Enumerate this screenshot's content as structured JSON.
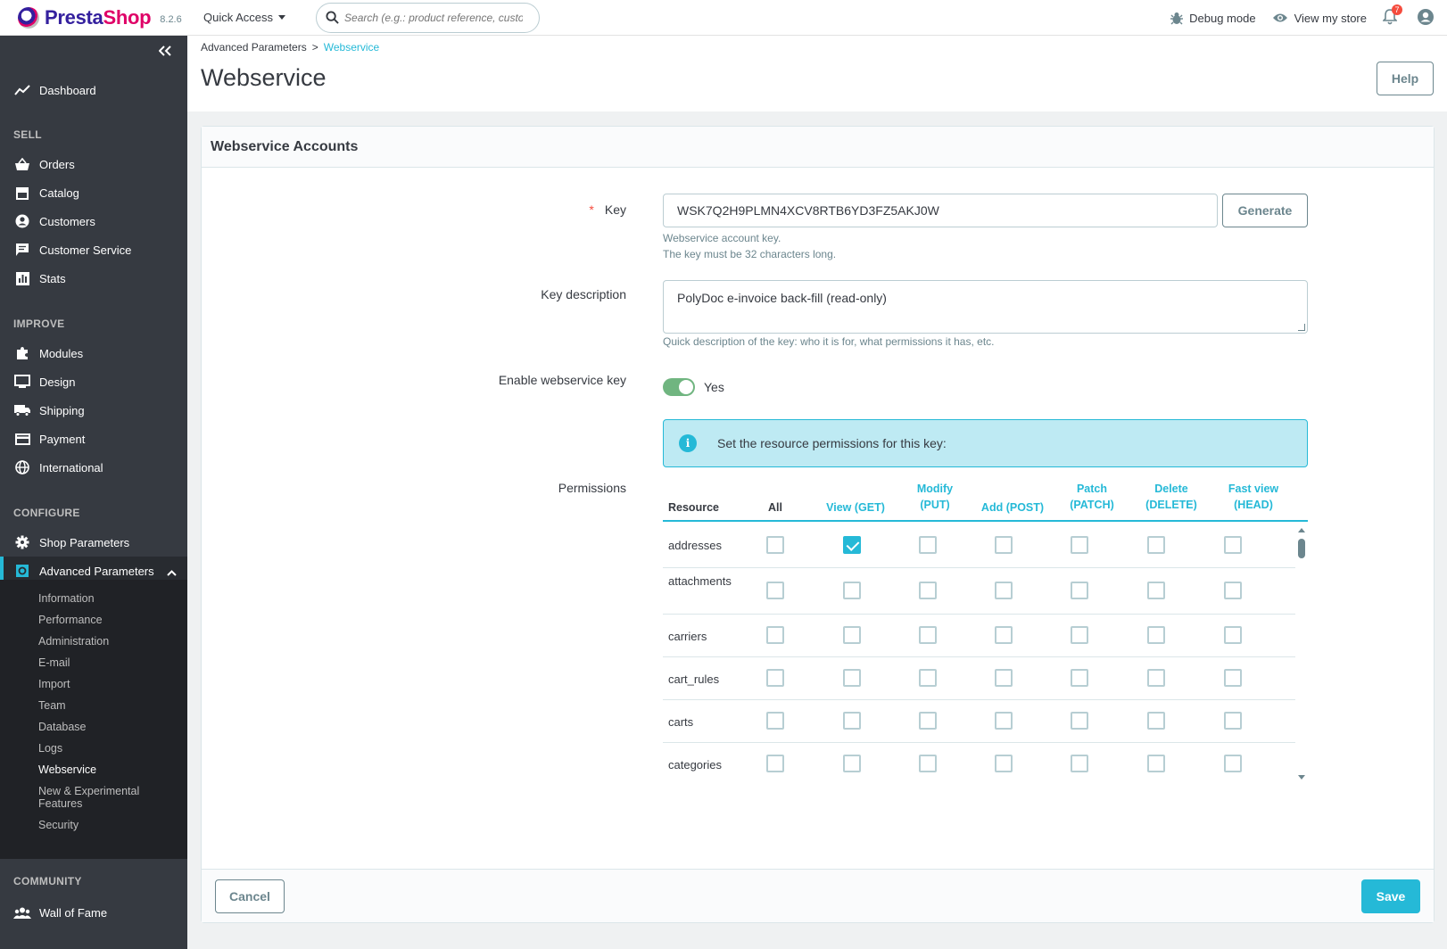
{
  "header": {
    "brand_presta": "Presta",
    "brand_shop": "Shop",
    "version": "8.2.6",
    "quick_access": "Quick Access",
    "search_placeholder": "Search (e.g.: product reference, custon",
    "debug_mode": "Debug mode",
    "view_store": "View my store",
    "notification_count": "7"
  },
  "sidebar": {
    "dashboard": "Dashboard",
    "sections": {
      "sell": "SELL",
      "improve": "IMPROVE",
      "configure": "CONFIGURE",
      "community": "COMMUNITY"
    },
    "sell_items": [
      "Orders",
      "Catalog",
      "Customers",
      "Customer Service",
      "Stats"
    ],
    "improve_items": [
      "Modules",
      "Design",
      "Shipping",
      "Payment",
      "International"
    ],
    "configure_items": [
      "Shop Parameters",
      "Advanced Parameters"
    ],
    "advanced_sub": [
      "Information",
      "Performance",
      "Administration",
      "E-mail",
      "Import",
      "Team",
      "Database",
      "Logs",
      "Webservice",
      "New & Experimental Features",
      "Security"
    ],
    "community_items": [
      "Wall of Fame"
    ]
  },
  "breadcrumb": {
    "parent": "Advanced Parameters",
    "separator": ">",
    "current": "Webservice"
  },
  "page_title": "Webservice",
  "help_label": "Help",
  "card": {
    "title": "Webservice Accounts",
    "key_label": "Key",
    "required_marker": "*",
    "key_value": "WSK7Q2H9PLMN4XCV8RTB6YD3FZ5AKJ0W",
    "generate_label": "Generate",
    "key_hint_1": "Webservice account key.",
    "key_hint_2": "The key must be 32 characters long.",
    "description_label": "Key description",
    "description_value": "PolyDoc e-invoice back-fill (read-only)",
    "description_hint": "Quick description of the key: who it is for, what permissions it has, etc.",
    "enable_label": "Enable webservice key",
    "enable_value": "Yes",
    "alert_text": "Set the resource permissions for this key:",
    "permissions_label": "Permissions",
    "cancel_label": "Cancel",
    "save_label": "Save"
  },
  "permissions": {
    "columns": [
      {
        "line1": "",
        "line2": "Resource"
      },
      {
        "line1": "",
        "line2": "All"
      },
      {
        "line1": "",
        "line2": "View (GET)"
      },
      {
        "line1": "Modify",
        "line2": "(PUT)"
      },
      {
        "line1": "",
        "line2": "Add (POST)"
      },
      {
        "line1": "Patch",
        "line2": "(PATCH)"
      },
      {
        "line1": "Delete",
        "line2": "(DELETE)"
      },
      {
        "line1": "Fast view",
        "line2": "(HEAD)"
      }
    ],
    "rows": [
      {
        "resource": "addresses",
        "checks": [
          false,
          true,
          false,
          false,
          false,
          false,
          false
        ]
      },
      {
        "resource": "attachments",
        "checks": [
          false,
          false,
          false,
          false,
          false,
          false,
          false
        ]
      },
      {
        "resource": "carriers",
        "checks": [
          false,
          false,
          false,
          false,
          false,
          false,
          false
        ]
      },
      {
        "resource": "cart_rules",
        "checks": [
          false,
          false,
          false,
          false,
          false,
          false,
          false
        ]
      },
      {
        "resource": "carts",
        "checks": [
          false,
          false,
          false,
          false,
          false,
          false,
          false
        ]
      },
      {
        "resource": "categories",
        "checks": [
          false,
          false,
          false,
          false,
          false,
          false,
          false
        ]
      }
    ]
  },
  "colors": {
    "accent": "#25b9d7",
    "sidebar_bg": "#363a41",
    "toggle_on": "#70b580",
    "brand_pink": "#df0067",
    "brand_purple": "#34209e"
  }
}
